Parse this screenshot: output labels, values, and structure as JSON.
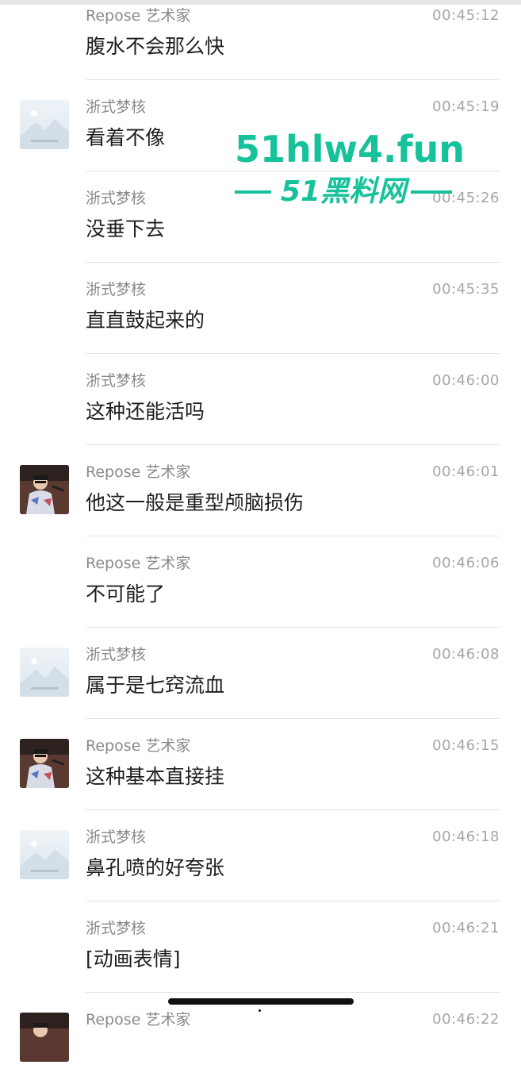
{
  "messages": [
    {
      "sender": "Repose 艺术家",
      "time": "00:45:12",
      "text": "腹水不会那么快",
      "avatar": "none"
    },
    {
      "sender": "浙式梦核",
      "time": "00:45:19",
      "text": "看着不像",
      "avatar": "placeholder-image-icon"
    },
    {
      "sender": "浙式梦核",
      "time": "00:45:26",
      "text": "没垂下去",
      "avatar": "none"
    },
    {
      "sender": "浙式梦核",
      "time": "00:45:35",
      "text": "直直鼓起来的",
      "avatar": "none"
    },
    {
      "sender": "浙式梦核",
      "time": "00:46:00",
      "text": "这种还能活吗",
      "avatar": "none"
    },
    {
      "sender": "Repose 艺术家",
      "time": "00:46:01",
      "text": "他这一般是重型颅脑损伤",
      "avatar": "user-photo-avatar"
    },
    {
      "sender": "Repose 艺术家",
      "time": "00:46:06",
      "text": "不可能了",
      "avatar": "none"
    },
    {
      "sender": "浙式梦核",
      "time": "00:46:08",
      "text": "属于是七窍流血",
      "avatar": "placeholder-image-icon"
    },
    {
      "sender": "Repose 艺术家",
      "time": "00:46:15",
      "text": "这种基本直接挂",
      "avatar": "user-photo-avatar"
    },
    {
      "sender": "浙式梦核",
      "time": "00:46:18",
      "text": "鼻孔喷的好夸张",
      "avatar": "placeholder-image-icon"
    },
    {
      "sender": "浙式梦核",
      "time": "00:46:21",
      "text": "[动画表情]",
      "avatar": "none"
    },
    {
      "sender": "Repose 艺术家",
      "time": "00:46:22",
      "text": "",
      "avatar": "user-photo-avatar"
    }
  ],
  "watermark": {
    "domain": "51hlw4.fun",
    "name": "51黑料网",
    "color": "#16c29a"
  },
  "colors": {
    "sender": "#8a8a8a",
    "time": "#a6a6a6",
    "text": "#1e1e1e",
    "divider": "#e3e3e3"
  }
}
